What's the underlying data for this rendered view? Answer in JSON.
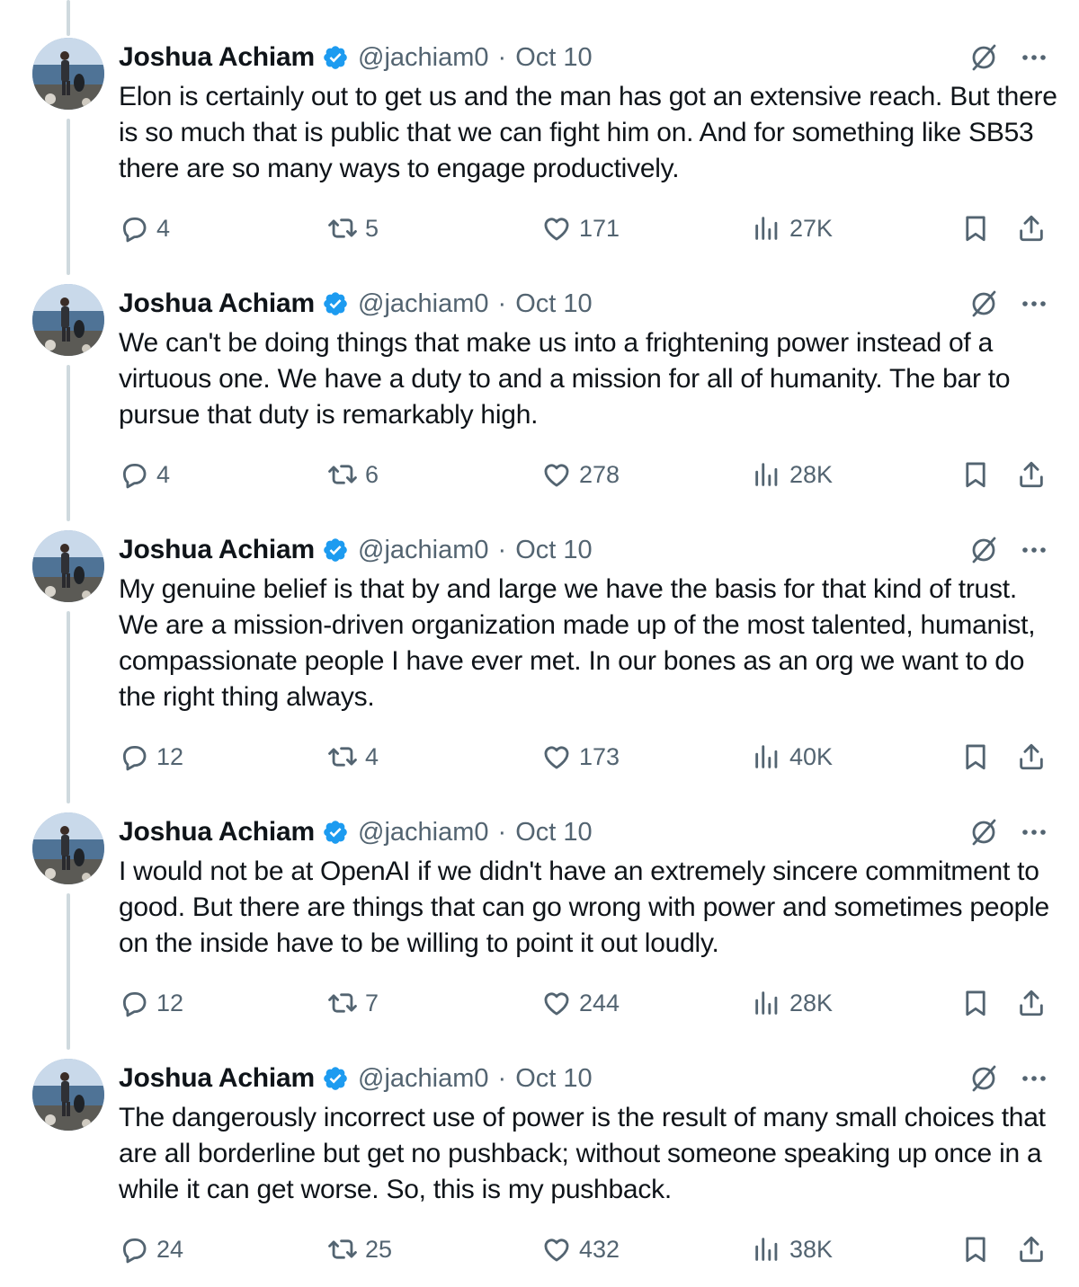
{
  "thread": {
    "tweets": [
      {
        "author_name": "Joshua Achiam",
        "handle": "@jachiam0",
        "separator": "·",
        "date": "Oct 10",
        "text": "Elon is certainly out to get us and the man has got an extensive reach. But there is so much that is public that we can fight him on. And for something like SB53 there are so many ways to engage productively.",
        "replies": "4",
        "reposts": "5",
        "likes": "171",
        "views": "27K"
      },
      {
        "author_name": "Joshua Achiam",
        "handle": "@jachiam0",
        "separator": "·",
        "date": "Oct 10",
        "text": "We can't be doing things that make us into a frightening power instead of a virtuous one. We have a duty to and a mission for all of humanity. The bar to pursue that duty is remarkably high.",
        "replies": "4",
        "reposts": "6",
        "likes": "278",
        "views": "28K"
      },
      {
        "author_name": "Joshua Achiam",
        "handle": "@jachiam0",
        "separator": "·",
        "date": "Oct 10",
        "text": "My genuine belief is that by and large we have the basis for that kind of trust. We are a mission-driven organization made up of the most talented, humanist, compassionate people I have ever met. In our bones as an org we want to do the right thing always.",
        "replies": "12",
        "reposts": "4",
        "likes": "173",
        "views": "40K"
      },
      {
        "author_name": "Joshua Achiam",
        "handle": "@jachiam0",
        "separator": "·",
        "date": "Oct 10",
        "text": "I would not be at OpenAI if we didn't have an extremely sincere commitment to good. But there are things that can go wrong with power and sometimes people on the inside have to be willing to point it out loudly.",
        "replies": "12",
        "reposts": "7",
        "likes": "244",
        "views": "28K"
      },
      {
        "author_name": "Joshua Achiam",
        "handle": "@jachiam0",
        "separator": "·",
        "date": "Oct 10",
        "text": "The dangerously incorrect use of power is the result of many small choices that are all borderline but get no pushback; without someone speaking up once in a while it can get worse. So, this is my pushback.",
        "replies": "24",
        "reposts": "25",
        "likes": "432",
        "views": "38K"
      }
    ]
  },
  "colors": {
    "text_primary": "#0f1419",
    "text_secondary": "#536471",
    "verified_badge": "#1d9bf0",
    "thread_line": "#cfd9de"
  },
  "icons": [
    "reply-icon",
    "repost-icon",
    "like-icon",
    "views-icon",
    "bookmark-icon",
    "share-icon",
    "grok-icon",
    "more-icon",
    "verified-badge-icon"
  ]
}
